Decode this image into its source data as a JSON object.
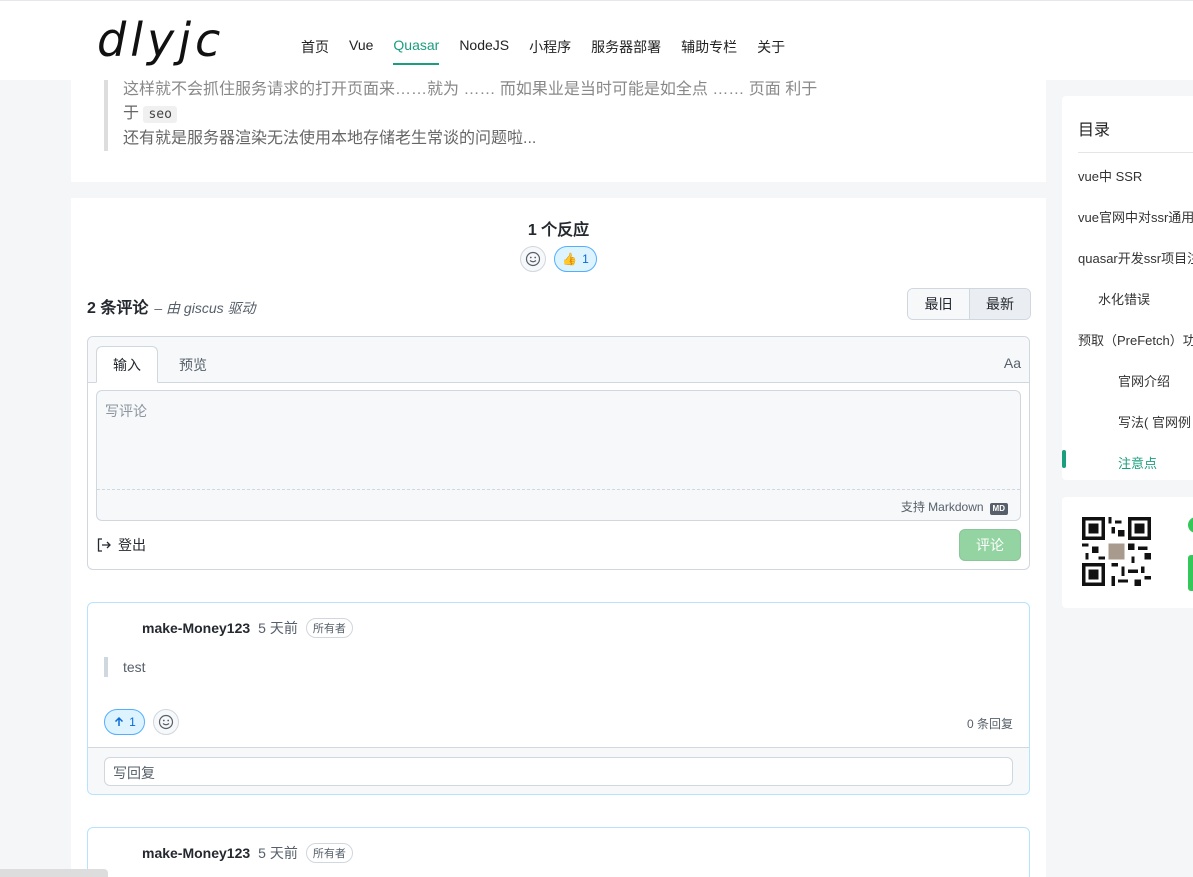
{
  "header": {
    "logo": "dlyjc",
    "nav": [
      {
        "label": "首页",
        "active": false
      },
      {
        "label": "Vue",
        "active": false
      },
      {
        "label": "Quasar",
        "active": true
      },
      {
        "label": "NodeJS",
        "active": false
      },
      {
        "label": "小程序",
        "active": false
      },
      {
        "label": "服务器部署",
        "active": false
      },
      {
        "label": "辅助专栏",
        "active": false
      },
      {
        "label": "关于",
        "active": false
      }
    ]
  },
  "article": {
    "quote_line1_partial": "这样就不会抓住服务请求的打开页面来……就为 …… 而如果业是当时可能是如全点 …… 页面 利于",
    "quote_line2_prefix": "于",
    "quote_line2_code": "seo",
    "quote_line3": "还有就是服务器渲染无法使用本地存储老生常谈的问题啦..."
  },
  "comments_section": {
    "reactions_title": "1 个反应",
    "thumb_count": "1",
    "count_title": "2 条评论",
    "powered_by": "– 由 giscus 驱动",
    "sort_oldest": "最旧",
    "sort_newest": "最新",
    "tab_write": "输入",
    "tab_preview": "预览",
    "font_toggle": "Aa",
    "placeholder": "写评论",
    "markdown_hint": "支持 Markdown",
    "markdown_icon": "MD",
    "logout": "登出",
    "submit": "评论",
    "comments": [
      {
        "author": "make-Money123",
        "time": "5 天前",
        "badge": "所有者",
        "body": "test",
        "upvotes": "1",
        "replies": "0 条回复",
        "reply_placeholder": "写回复"
      },
      {
        "author": "make-Money123",
        "time": "5 天前",
        "badge": "所有者"
      }
    ]
  },
  "toc": {
    "title": "目录",
    "items": [
      {
        "label": "vue中 SSR",
        "level": 1
      },
      {
        "label": "vue官网中对ssr通用",
        "level": 1
      },
      {
        "label": "quasar开发ssr项目注",
        "level": 1
      },
      {
        "label": "水化错误",
        "level": 2
      },
      {
        "label": "预取（PreFetch）功",
        "level": 1
      },
      {
        "label": "官网介绍",
        "level": 3
      },
      {
        "label": "写法( 官网例",
        "level": 3
      },
      {
        "label": "注意点",
        "level": 3,
        "active": true
      }
    ]
  },
  "colors": {
    "accent": "#1a9e7e",
    "link_blue": "#0969da",
    "submit_green": "#94d3a2"
  }
}
